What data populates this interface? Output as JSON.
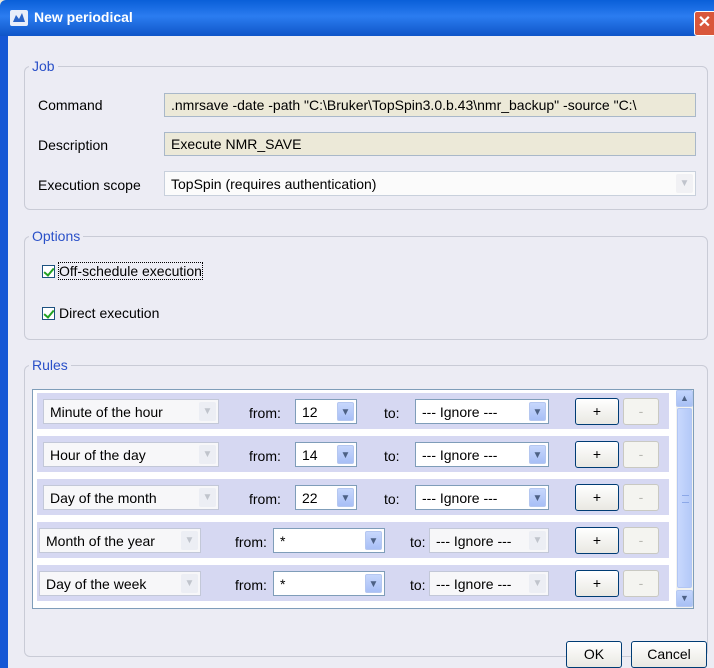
{
  "window": {
    "title": "New periodical",
    "close_glyph": "✕"
  },
  "job": {
    "legend": "Job",
    "command_label": "Command",
    "command_value": ".nmrsave -date -path \"C:\\Bruker\\TopSpin3.0.b.43\\nmr_backup\" -source \"C:\\",
    "description_label": "Description",
    "description_value": "Execute NMR_SAVE",
    "scope_label": "Execution scope",
    "scope_value": "TopSpin (requires authentication)"
  },
  "options": {
    "legend": "Options",
    "off_schedule_label": "Off-schedule execution",
    "off_schedule_checked": true,
    "direct_label": "Direct execution",
    "direct_checked": true
  },
  "rules": {
    "legend": "Rules",
    "from_label": "from:",
    "to_label": "to:",
    "add_label": "+",
    "remove_label": "-",
    "rows": [
      {
        "unit": "Minute of the hour",
        "from": "12",
        "to": "--- Ignore ---"
      },
      {
        "unit": "Hour of the day",
        "from": "14",
        "to": "--- Ignore ---"
      },
      {
        "unit": "Day of the month",
        "from": "22",
        "to": "--- Ignore ---"
      },
      {
        "unit": "Month of the year",
        "from": "*",
        "to": "--- Ignore ---"
      },
      {
        "unit": "Day of the week",
        "from": "*",
        "to": "--- Ignore ---"
      }
    ]
  },
  "buttons": {
    "ok": "OK",
    "cancel": "Cancel"
  },
  "colors": {
    "titlebar": "#0a5fd8",
    "legend": "#2a50c8",
    "rule_row": "#d6d8f2",
    "close": "#d9573b"
  },
  "icons": {
    "app": "topspin-app-icon",
    "dropdown": "chevron-down-icon"
  }
}
